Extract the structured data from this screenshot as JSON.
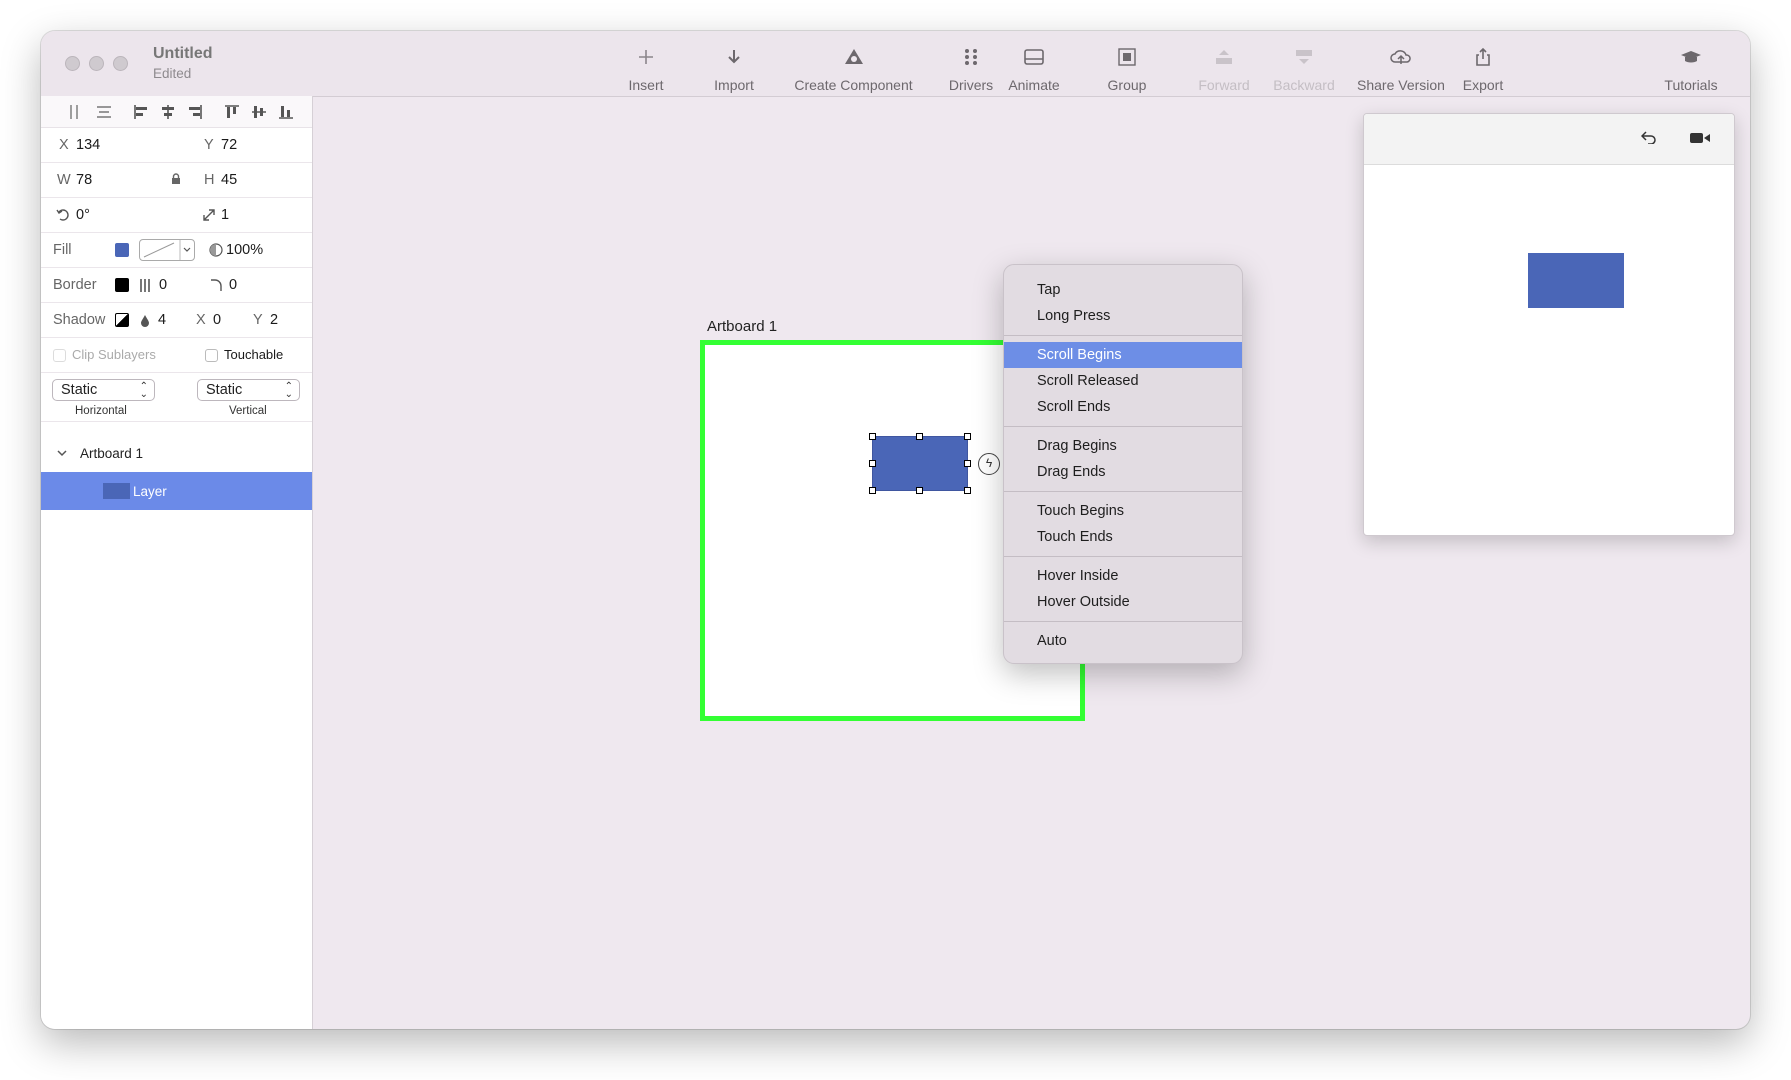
{
  "window": {
    "title": "Untitled",
    "subtitle": "Edited"
  },
  "toolbar": [
    {
      "label": "Insert",
      "icon": "plus-icon",
      "enabled": true
    },
    {
      "label": "Import",
      "icon": "arrow-down-icon",
      "enabled": true
    },
    {
      "label": "Create Component",
      "icon": "shapes-icon",
      "enabled": true
    },
    {
      "label": "Drivers",
      "icon": "dots-icon",
      "enabled": true
    },
    {
      "label": "Animate",
      "icon": "animate-icon",
      "enabled": true
    },
    {
      "label": "Group",
      "icon": "group-icon",
      "enabled": true
    },
    {
      "label": "Forward",
      "icon": "forward-icon",
      "enabled": false
    },
    {
      "label": "Backward",
      "icon": "backward-icon",
      "enabled": false
    },
    {
      "label": "Share Version",
      "icon": "cloud-upload-icon",
      "enabled": true
    },
    {
      "label": "Export",
      "icon": "share-icon",
      "enabled": true
    },
    {
      "label": "Tutorials",
      "icon": "graduation-cap-icon",
      "enabled": true
    }
  ],
  "inspector": {
    "x_label": "X",
    "x": "134",
    "y_label": "Y",
    "y": "72",
    "w_label": "W",
    "w": "78",
    "h_label": "H",
    "h": "45",
    "rotation": "0°",
    "scale": "1",
    "fill_label": "Fill",
    "fill_color": "#4a66b7",
    "opacity": "100%",
    "border_label": "Border",
    "border_color": "#000000",
    "border_width": "0",
    "corner_radius": "0",
    "shadow_label": "Shadow",
    "shadow_blur": "4",
    "shadow_x_label": "X",
    "shadow_x": "0",
    "shadow_y_label": "Y",
    "shadow_y": "2",
    "clip_sublayers": "Clip Sublayers",
    "touchable": "Touchable",
    "horizontal_value": "Static",
    "horizontal_label": "Horizontal",
    "vertical_value": "Static",
    "vertical_label": "Vertical"
  },
  "layers": {
    "artboard": "Artboard 1",
    "layer": "Layer"
  },
  "canvas": {
    "artboard_label": "Artboard 1"
  },
  "context_menu": {
    "groups": [
      [
        "Tap",
        "Long Press"
      ],
      [
        "Scroll Begins",
        "Scroll Released",
        "Scroll Ends"
      ],
      [
        "Drag Begins",
        "Drag Ends"
      ],
      [
        "Touch Begins",
        "Touch Ends"
      ],
      [
        "Hover Inside",
        "Hover Outside"
      ],
      [
        "Auto"
      ]
    ],
    "highlighted": "Scroll Begins"
  },
  "colors": {
    "accent": "#6d8ee6",
    "layer": "#4a66b7",
    "artboard_border": "#33ff33"
  }
}
